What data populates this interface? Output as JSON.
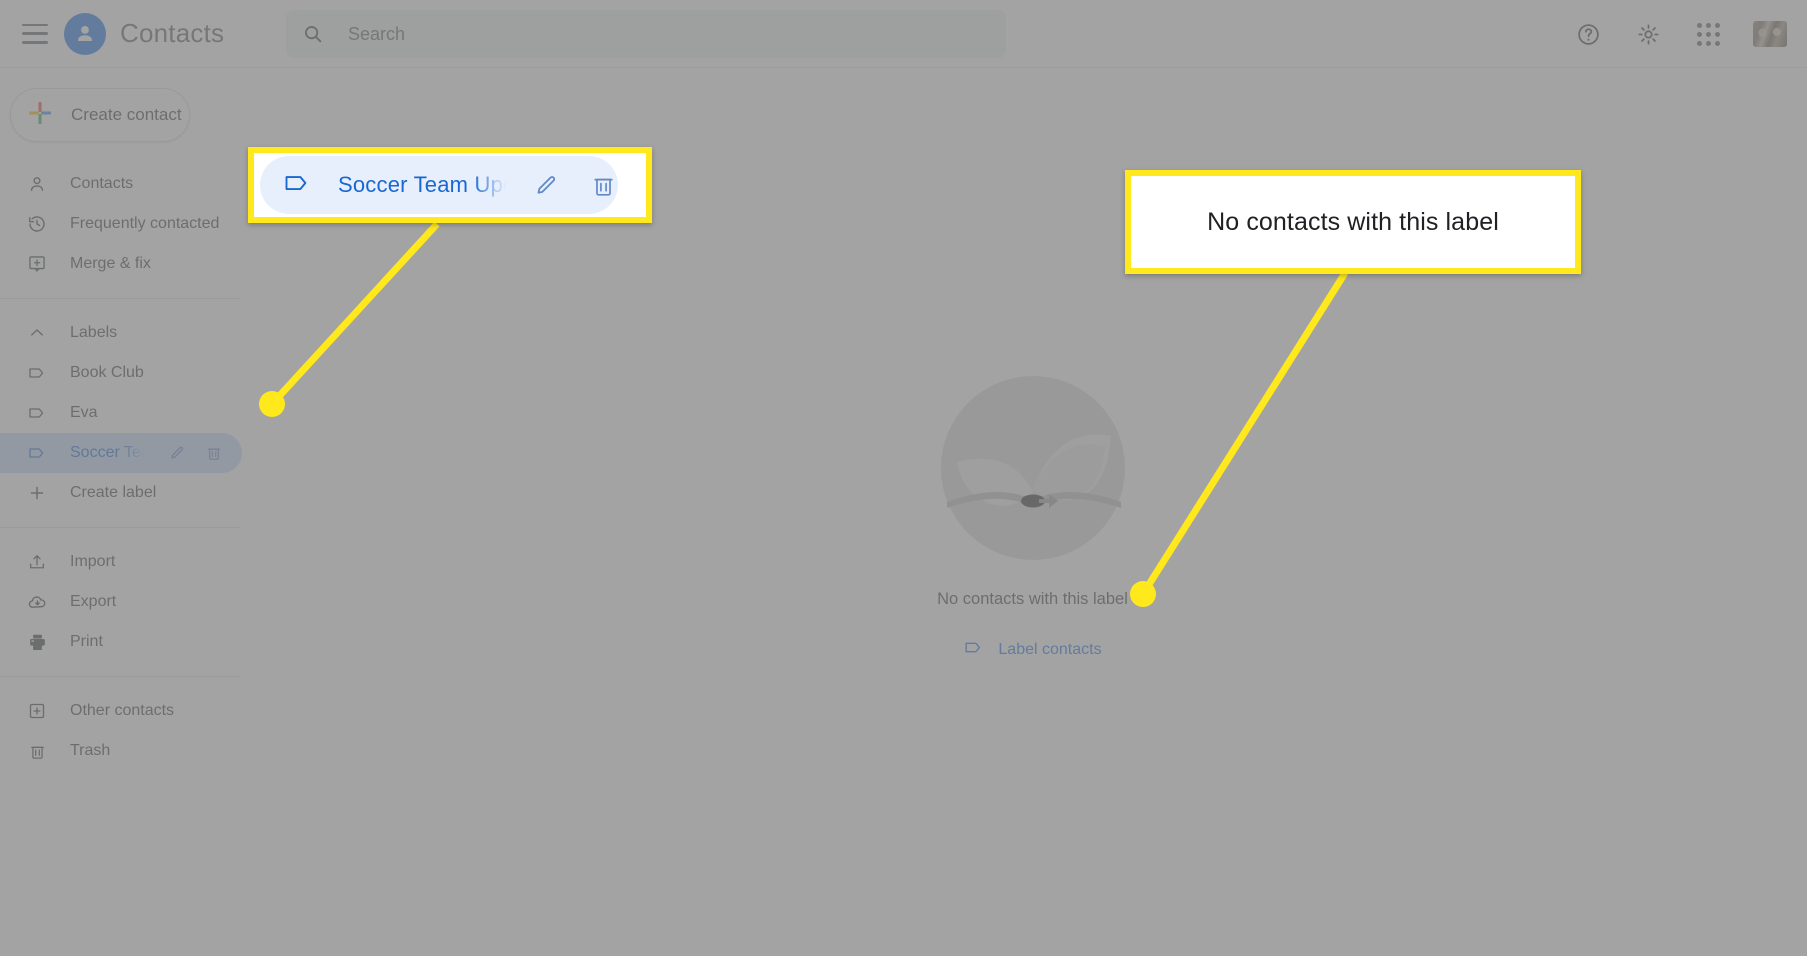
{
  "app": {
    "title": "Contacts",
    "logo_icon": "person-circle-icon",
    "menu_icon": "hamburger-menu-icon"
  },
  "search": {
    "placeholder": "Search",
    "value": "",
    "icon": "search-icon"
  },
  "header_actions": [
    {
      "name": "help-icon",
      "label": "Help",
      "icon": "question-mark-circle-icon"
    },
    {
      "name": "settings-icon",
      "label": "Settings",
      "icon": "gear-icon"
    },
    {
      "name": "apps-icon",
      "label": "Google apps",
      "icon": "apps-grid-icon"
    },
    {
      "name": "account-avatar",
      "label": "Account",
      "icon": "avatar-icon"
    }
  ],
  "sidebar": {
    "create_contact": {
      "label": "Create contact",
      "icon": "plus-multicolor-icon"
    },
    "primary_items": [
      {
        "label": "Contacts",
        "icon": "person-outline-icon",
        "selected": false
      },
      {
        "label": "Frequently contacted",
        "icon": "history-clock-icon",
        "selected": false
      },
      {
        "label": "Merge & fix",
        "icon": "merge-fix-icon",
        "selected": false
      }
    ],
    "labels_header": {
      "label": "Labels",
      "icon": "chevron-up-icon"
    },
    "labels": [
      {
        "label": "Book Club",
        "icon": "label-tag-icon",
        "selected": false
      },
      {
        "label": "Eva",
        "icon": "label-tag-icon",
        "selected": false
      },
      {
        "label": "Soccer Team Upd",
        "icon": "label-tag-icon",
        "selected": true,
        "edit_icon": "pencil-edit-icon",
        "delete_icon": "trash-delete-icon"
      }
    ],
    "create_label": {
      "label": "Create label",
      "icon": "plus-icon"
    },
    "tools": [
      {
        "label": "Import",
        "icon": "upload-import-icon"
      },
      {
        "label": "Export",
        "icon": "cloud-download-export-icon"
      },
      {
        "label": "Print",
        "icon": "printer-icon"
      }
    ],
    "footer_items": [
      {
        "label": "Other contacts",
        "icon": "other-contacts-icon"
      },
      {
        "label": "Trash",
        "icon": "trash-icon"
      }
    ]
  },
  "main": {
    "empty_illustration_icon": "open-address-book-illustration",
    "empty_text": "No contacts with this label",
    "label_contacts_link": {
      "label": "Label contacts",
      "icon": "label-tag-icon"
    }
  },
  "annotations": {
    "callout_label": {
      "name": "Soccer Team Upd",
      "label_icon": "label-tag-icon",
      "edit_icon": "pencil-edit-icon",
      "delete_icon": "trash-delete-icon"
    },
    "callout_empty": {
      "text": "No contacts with this label"
    }
  },
  "colors": {
    "highlight": "#ffe81c",
    "accent_blue": "#1a73e8",
    "selected_blue": "#1967d2",
    "selected_row_bg": "#c2dbff"
  }
}
